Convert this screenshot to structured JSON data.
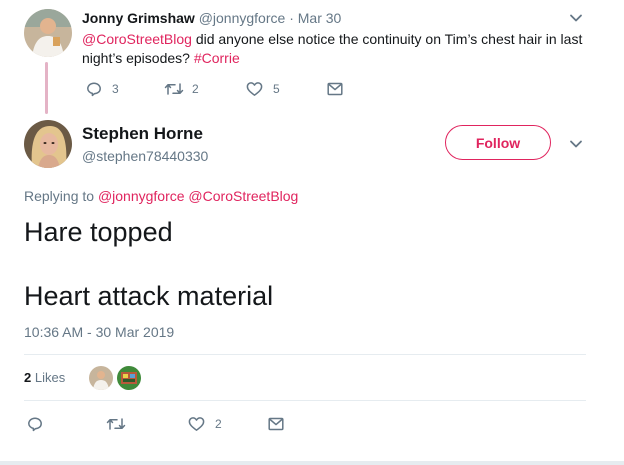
{
  "parent_tweet": {
    "name": "Jonny Grimshaw",
    "handle": "@jonnygforce",
    "separator": "·",
    "date": "Mar 30",
    "mention": "@CoroStreetBlog",
    "text_before_hashtag": " did anyone else notice the continuity on Tim’s chest hair in last night’s episodes? ",
    "hashtag": "#Corrie",
    "reply_count": "3",
    "retweet_count": "2",
    "like_count": "5"
  },
  "main_tweet": {
    "name": "Stephen Horne",
    "handle": "@stephen78440330",
    "follow_label": "Follow",
    "replying_prefix": "Replying to ",
    "replying_mentions": "@jonnygforce @CoroStreetBlog",
    "body_line_1": "Hare topped",
    "body_line_2": "Heart attack material",
    "timestamp": "10:36 AM - 30 Mar 2019",
    "likes_count": "2",
    "likes_label": " Likes",
    "like_action_count": "2"
  },
  "icons": {
    "caret": "chevron-down-icon",
    "reply": "reply-icon",
    "retweet": "retweet-icon",
    "like": "heart-icon",
    "dm": "envelope-icon"
  },
  "colors": {
    "accent": "#e0245e",
    "secondary_text": "#657786",
    "divider": "#e6ecf0",
    "thread_line": "#e4b3c6"
  }
}
